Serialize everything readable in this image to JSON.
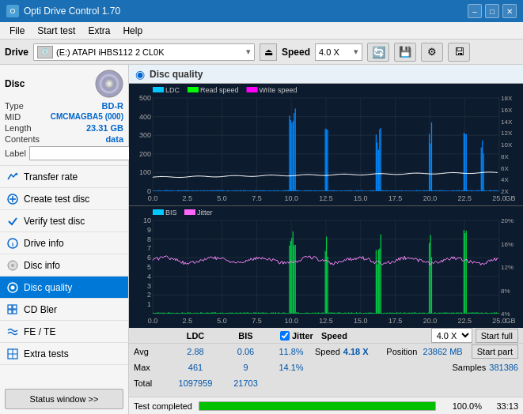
{
  "titleBar": {
    "title": "Opti Drive Control 1.70",
    "minBtn": "–",
    "maxBtn": "□",
    "closeBtn": "✕"
  },
  "menuBar": {
    "items": [
      "File",
      "Start test",
      "Extra",
      "Help"
    ]
  },
  "driveBar": {
    "label": "Drive",
    "driveValue": "(E:) ATAPI iHBS112  2 CL0K",
    "speedLabel": "Speed",
    "speedValue": "4.0 X"
  },
  "disc": {
    "title": "Disc",
    "typeLabel": "Type",
    "typeValue": "BD-R",
    "midLabel": "MID",
    "midValue": "CMCMAGBA5 (000)",
    "lengthLabel": "Length",
    "lengthValue": "23.31 GB",
    "contentsLabel": "Contents",
    "contentsValue": "data",
    "labelLabel": "Label",
    "labelValue": ""
  },
  "nav": {
    "items": [
      {
        "id": "transfer-rate",
        "label": "Transfer rate",
        "icon": "↗"
      },
      {
        "id": "create-test-disc",
        "label": "Create test disc",
        "icon": "⊕"
      },
      {
        "id": "verify-test-disc",
        "label": "Verify test disc",
        "icon": "✓"
      },
      {
        "id": "drive-info",
        "label": "Drive info",
        "icon": "ℹ"
      },
      {
        "id": "disc-info",
        "label": "Disc info",
        "icon": "💿"
      },
      {
        "id": "disc-quality",
        "label": "Disc quality",
        "icon": "◉",
        "active": true
      },
      {
        "id": "cd-bler",
        "label": "CD Bler",
        "icon": "▦"
      },
      {
        "id": "fe-te",
        "label": "FE / TE",
        "icon": "≈"
      },
      {
        "id": "extra-tests",
        "label": "Extra tests",
        "icon": "⊞"
      }
    ],
    "statusBtn": "Status window >>"
  },
  "chartHeader": {
    "title": "Disc quality",
    "icon": "◉"
  },
  "chartTop": {
    "legend": [
      "LDC",
      "Read speed",
      "Write speed"
    ],
    "yMax": 500,
    "yRightLabels": [
      "18X",
      "16X",
      "14X",
      "12X",
      "10X",
      "8X",
      "6X",
      "4X",
      "2X"
    ],
    "xMax": 25.0
  },
  "chartBottom": {
    "legend": [
      "BIS",
      "Jitter"
    ],
    "yMax": 10,
    "yRightLabels": [
      "20%",
      "16%",
      "12%",
      "8%",
      "4%"
    ],
    "xMax": 25.0
  },
  "statsTable": {
    "headers": [
      "",
      "LDC",
      "BIS",
      "",
      "Jitter",
      "Speed",
      "",
      ""
    ],
    "rows": [
      {
        "label": "Avg",
        "ldc": "2.88",
        "bis": "0.06",
        "jitter": "11.8%",
        "speed": "4.18 X"
      },
      {
        "label": "Max",
        "ldc": "461",
        "bis": "9",
        "jitter": "14.1%"
      },
      {
        "label": "Total",
        "ldc": "1097959",
        "bis": "21703",
        "jitter": ""
      }
    ],
    "position": {
      "label": "Position",
      "value": "23862 MB"
    },
    "samples": {
      "label": "Samples",
      "value": "381386"
    },
    "speedDropdown": "4.0 X",
    "startFullBtn": "Start full",
    "startPartBtn": "Start part",
    "jitterCheckLabel": "Jitter",
    "jitterChecked": true
  },
  "statusBar": {
    "text": "Test completed",
    "progress": 100.0,
    "time": "33:13"
  }
}
